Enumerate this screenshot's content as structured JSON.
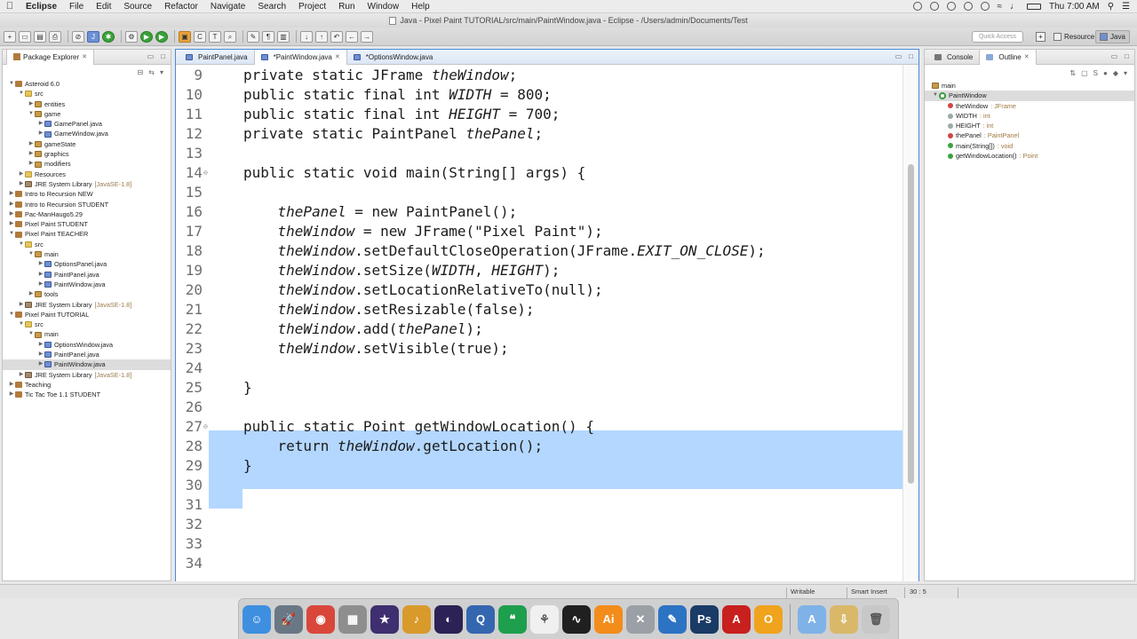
{
  "menubar": {
    "app": "Eclipse",
    "items": [
      "File",
      "Edit",
      "Source",
      "Refactor",
      "Navigate",
      "Search",
      "Project",
      "Run",
      "Window",
      "Help"
    ],
    "clock": "Thu 7:00 AM"
  },
  "window": {
    "title": "Java - Pixel Paint TUTORIAL/src/main/PaintWindow.java - Eclipse - /Users/admin/Documents/Test"
  },
  "toolbar": {
    "quick_access_placeholder": "Quick Access",
    "perspectives": [
      {
        "label": "Resource",
        "active": false
      },
      {
        "label": "Java",
        "active": true
      }
    ]
  },
  "package_explorer": {
    "title": "Package Explorer",
    "tree": [
      {
        "label": "Asteroid 6.0",
        "depth": 0,
        "icon": "project-icon",
        "exp": "open"
      },
      {
        "label": "src",
        "depth": 1,
        "icon": "folder-icon",
        "exp": "open"
      },
      {
        "label": "entities",
        "depth": 2,
        "icon": "package-icon",
        "exp": "closed"
      },
      {
        "label": "game",
        "depth": 2,
        "icon": "package-icon",
        "exp": "open"
      },
      {
        "label": "GamePanel.java",
        "depth": 3,
        "icon": "java-file-icon",
        "exp": "closed"
      },
      {
        "label": "GameWindow.java",
        "depth": 3,
        "icon": "java-file-icon",
        "exp": "closed"
      },
      {
        "label": "gameState",
        "depth": 2,
        "icon": "package-icon",
        "exp": "closed"
      },
      {
        "label": "graphics",
        "depth": 2,
        "icon": "package-icon",
        "exp": "closed"
      },
      {
        "label": "modifiers",
        "depth": 2,
        "icon": "package-icon",
        "exp": "closed"
      },
      {
        "label": "Resources",
        "depth": 1,
        "icon": "folder-icon",
        "exp": "closed"
      },
      {
        "label": "JRE System Library",
        "extra": "[JavaSE-1.8]",
        "depth": 1,
        "icon": "library-icon",
        "exp": "closed"
      },
      {
        "label": "Intro to Recursion NEW",
        "depth": 0,
        "icon": "project-icon",
        "exp": "closed"
      },
      {
        "label": "Intro to Recursion STUDENT",
        "depth": 0,
        "icon": "project-icon",
        "exp": "closed"
      },
      {
        "label": "Pac-ManHaugo5.29",
        "depth": 0,
        "icon": "project-icon",
        "exp": "closed"
      },
      {
        "label": "Pixel Paint STUDENT",
        "depth": 0,
        "icon": "project-icon",
        "exp": "closed"
      },
      {
        "label": "Pixel Paint TEACHER",
        "depth": 0,
        "icon": "project-icon",
        "exp": "open"
      },
      {
        "label": "src",
        "depth": 1,
        "icon": "folder-icon",
        "exp": "open"
      },
      {
        "label": "main",
        "depth": 2,
        "icon": "package-icon",
        "exp": "open"
      },
      {
        "label": "OptionsPanel.java",
        "depth": 3,
        "icon": "java-file-icon",
        "exp": "closed"
      },
      {
        "label": "PaintPanel.java",
        "depth": 3,
        "icon": "java-file-icon",
        "exp": "closed"
      },
      {
        "label": "PaintWindow.java",
        "depth": 3,
        "icon": "java-file-icon",
        "exp": "closed"
      },
      {
        "label": "tools",
        "depth": 2,
        "icon": "package-icon",
        "exp": "closed"
      },
      {
        "label": "JRE System Library",
        "extra": "[JavaSE-1.8]",
        "depth": 1,
        "icon": "library-icon",
        "exp": "closed"
      },
      {
        "label": "Pixel Paint TUTORIAL",
        "depth": 0,
        "icon": "project-icon",
        "exp": "open"
      },
      {
        "label": "src",
        "depth": 1,
        "icon": "folder-icon",
        "exp": "open"
      },
      {
        "label": "main",
        "depth": 2,
        "icon": "package-icon",
        "exp": "open"
      },
      {
        "label": "OptionsWindow.java",
        "depth": 3,
        "icon": "java-file-icon",
        "exp": "closed"
      },
      {
        "label": "PaintPanel.java",
        "depth": 3,
        "icon": "java-file-icon",
        "exp": "closed"
      },
      {
        "label": "PaintWindow.java",
        "depth": 3,
        "icon": "java-file-icon",
        "exp": "closed",
        "selected": true
      },
      {
        "label": "JRE System Library",
        "extra": "[JavaSE-1.8]",
        "depth": 1,
        "icon": "library-icon",
        "exp": "closed"
      },
      {
        "label": "Teaching",
        "depth": 0,
        "icon": "project-icon",
        "exp": "closed"
      },
      {
        "label": "Tic Tac Toe 1.1 STUDENT",
        "depth": 0,
        "icon": "project-icon",
        "exp": "closed"
      }
    ]
  },
  "editor": {
    "tabs": [
      {
        "label": "PaintPanel.java",
        "active": false
      },
      {
        "label": "*PaintWindow.java",
        "active": true
      },
      {
        "label": "*OptionsWindow.java",
        "active": false
      }
    ],
    "lines": [
      {
        "n": "9",
        "fold": "",
        "segs": [
          {
            "t": "private static JFrame "
          },
          {
            "t": "theWindow",
            "i": 1
          },
          {
            "t": ";"
          }
        ]
      },
      {
        "n": "10",
        "fold": "",
        "segs": [
          {
            "t": "public static final int "
          },
          {
            "t": "WIDTH",
            "i": 1
          },
          {
            "t": " = 800;"
          }
        ]
      },
      {
        "n": "11",
        "fold": "",
        "segs": [
          {
            "t": "public static final int "
          },
          {
            "t": "HEIGHT",
            "i": 1
          },
          {
            "t": " = 700;"
          }
        ]
      },
      {
        "n": "12",
        "fold": "",
        "segs": [
          {
            "t": "private static PaintPanel "
          },
          {
            "t": "thePanel",
            "i": 1
          },
          {
            "t": ";"
          }
        ]
      },
      {
        "n": "13",
        "fold": "",
        "segs": []
      },
      {
        "n": "14",
        "fold": "⊖",
        "segs": [
          {
            "t": "public static void main(String[] args) {"
          }
        ]
      },
      {
        "n": "15",
        "fold": "",
        "segs": []
      },
      {
        "n": "16",
        "fold": "",
        "segs": [
          {
            "t": "    "
          },
          {
            "t": "thePanel",
            "i": 1
          },
          {
            "t": " = new PaintPanel();"
          }
        ]
      },
      {
        "n": "17",
        "fold": "",
        "segs": [
          {
            "t": "    "
          },
          {
            "t": "theWindow",
            "i": 1
          },
          {
            "t": " = new JFrame(\"Pixel Paint\");"
          }
        ]
      },
      {
        "n": "18",
        "fold": "",
        "segs": [
          {
            "t": "    "
          },
          {
            "t": "theWindow",
            "i": 1
          },
          {
            "t": ".setDefaultCloseOperation(JFrame."
          },
          {
            "t": "EXIT_ON_CLOSE",
            "i": 1
          },
          {
            "t": ");"
          }
        ]
      },
      {
        "n": "19",
        "fold": "",
        "segs": [
          {
            "t": "    "
          },
          {
            "t": "theWindow",
            "i": 1
          },
          {
            "t": ".setSize("
          },
          {
            "t": "WIDTH",
            "i": 1
          },
          {
            "t": ", "
          },
          {
            "t": "HEIGHT",
            "i": 1
          },
          {
            "t": ");"
          }
        ]
      },
      {
        "n": "20",
        "fold": "",
        "segs": [
          {
            "t": "    "
          },
          {
            "t": "theWindow",
            "i": 1
          },
          {
            "t": ".setLocationRelativeTo(null);"
          }
        ]
      },
      {
        "n": "21",
        "fold": "",
        "segs": [
          {
            "t": "    "
          },
          {
            "t": "theWindow",
            "i": 1
          },
          {
            "t": ".setResizable(false);"
          }
        ]
      },
      {
        "n": "22",
        "fold": "",
        "segs": [
          {
            "t": "    "
          },
          {
            "t": "theWindow",
            "i": 1
          },
          {
            "t": ".add("
          },
          {
            "t": "thePanel",
            "i": 1
          },
          {
            "t": ");"
          }
        ]
      },
      {
        "n": "23",
        "fold": "",
        "segs": [
          {
            "t": "    "
          },
          {
            "t": "theWindow",
            "i": 1
          },
          {
            "t": ".setVisible(true);"
          }
        ]
      },
      {
        "n": "24",
        "fold": "",
        "segs": []
      },
      {
        "n": "25",
        "fold": "",
        "segs": [
          {
            "t": "}"
          }
        ]
      },
      {
        "n": "26",
        "fold": "",
        "segs": []
      },
      {
        "n": "27",
        "fold": "⊖",
        "segs": [
          {
            "t": "public static Point getWindowLocation() {"
          }
        ]
      },
      {
        "n": "28",
        "fold": "",
        "segs": [
          {
            "t": "    return "
          },
          {
            "t": "theWindow",
            "i": 1
          },
          {
            "t": ".getLocation();"
          }
        ]
      },
      {
        "n": "29",
        "fold": "",
        "segs": [
          {
            "t": "}"
          }
        ]
      },
      {
        "n": "30",
        "fold": "",
        "segs": []
      },
      {
        "n": "31",
        "fold": "",
        "segs": []
      },
      {
        "n": "32",
        "fold": "",
        "segs": []
      },
      {
        "n": "33",
        "fold": "",
        "segs": []
      },
      {
        "n": "34",
        "fold": "",
        "segs": []
      }
    ]
  },
  "right_panel": {
    "tabs": [
      {
        "label": "Console",
        "active": false
      },
      {
        "label": "Outline",
        "active": true
      }
    ],
    "outline": [
      {
        "label": "main",
        "type": "",
        "icon": "package-icon",
        "depth": 0
      },
      {
        "label": "PaintWindow",
        "type": "",
        "icon": "class-icon",
        "depth": 0,
        "selected": true
      },
      {
        "label": "theWindow",
        "type": ": JFrame",
        "icon": "private-static-field-icon",
        "depth": 1
      },
      {
        "label": "WIDTH",
        "type": ": int",
        "icon": "final-field-icon",
        "depth": 1
      },
      {
        "label": "HEIGHT",
        "type": ": int",
        "icon": "final-field-icon",
        "depth": 1
      },
      {
        "label": "thePanel",
        "type": ": PaintPanel",
        "icon": "private-static-field-icon",
        "depth": 1
      },
      {
        "label": "main(String[])",
        "type": ": void",
        "icon": "public-method-icon",
        "depth": 1
      },
      {
        "label": "getWindowLocation()",
        "type": ": Point",
        "icon": "public-method-icon",
        "depth": 1
      }
    ]
  },
  "status_bar": {
    "writable": "Writable",
    "insert_mode": "Smart Insert",
    "position": "30 : 5"
  },
  "dock": {
    "apps": [
      {
        "icon": "finder-icon",
        "color": "#3f8fe0",
        "glyph": "☺"
      },
      {
        "icon": "launchpad-icon",
        "color": "#6a7785",
        "glyph": "🚀"
      },
      {
        "icon": "chrome-icon",
        "color": "#d9473b",
        "glyph": "◉"
      },
      {
        "icon": "calculator-icon",
        "color": "#8e8e8e",
        "glyph": "▦"
      },
      {
        "icon": "imovie-icon",
        "color": "#3f2f70",
        "glyph": "★"
      },
      {
        "icon": "garageband-icon",
        "color": "#d99a2c",
        "glyph": "♪"
      },
      {
        "icon": "eclipse-icon",
        "color": "#2c2255",
        "glyph": "◐"
      },
      {
        "icon": "quicktime-icon",
        "color": "#3566b0",
        "glyph": "Q"
      },
      {
        "icon": "hangouts-icon",
        "color": "#1e9f4d",
        "glyph": "❝"
      },
      {
        "icon": "photos-icon",
        "color": "#f0f0f0",
        "glyph": "⚘"
      },
      {
        "icon": "activity-monitor-icon",
        "color": "#202020",
        "glyph": "∿"
      },
      {
        "icon": "illustrator-icon",
        "color": "#f28c1b",
        "glyph": "Ai"
      },
      {
        "icon": "utilities-icon",
        "color": "#9aa0a6",
        "glyph": "✕"
      },
      {
        "icon": "textedit-icon",
        "color": "#2d73c4",
        "glyph": "✎"
      },
      {
        "icon": "photoshop-icon",
        "color": "#1a3b66",
        "glyph": "Ps"
      },
      {
        "icon": "acrobat-icon",
        "color": "#c8201e",
        "glyph": "A"
      },
      {
        "icon": "outlook-icon",
        "color": "#f0a31c",
        "glyph": "O"
      }
    ],
    "trailing": [
      {
        "icon": "applications-folder-icon",
        "color": "#7fb2e6",
        "glyph": "A"
      },
      {
        "icon": "downloads-icon",
        "color": "#d9b86a",
        "glyph": "⇩"
      },
      {
        "icon": "trash-icon",
        "color": "#c8c8c8",
        "glyph": "🗑"
      }
    ]
  }
}
